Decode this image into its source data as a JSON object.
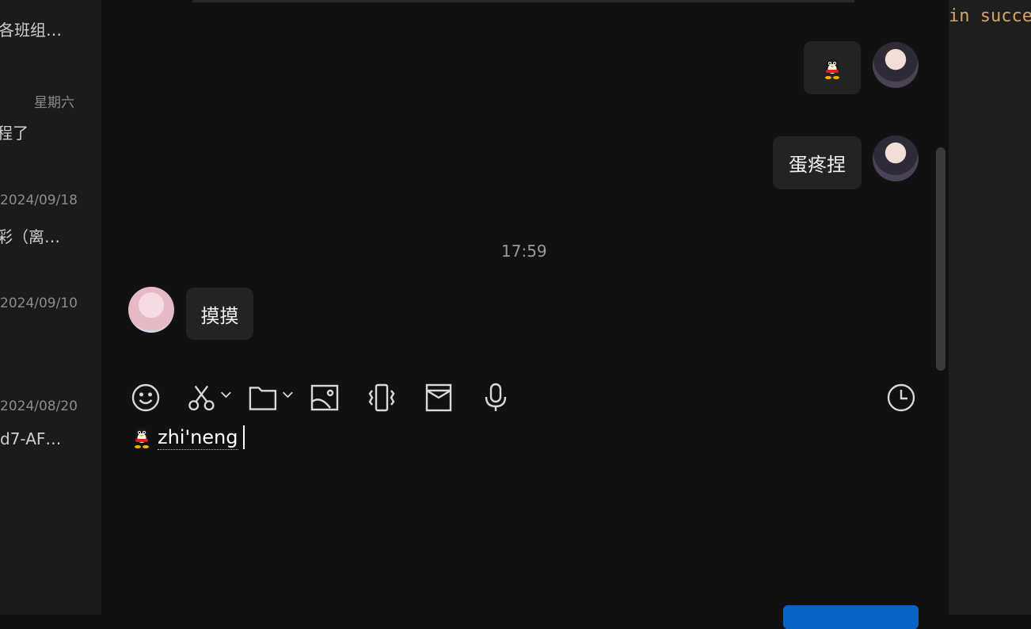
{
  "conversation_list": {
    "items": [
      {
        "preview": "各班组…",
        "date": "星期六"
      },
      {
        "preview": "程了",
        "date": "2024/09/18"
      },
      {
        "preview": "彩（离…",
        "date": "2024/09/10"
      },
      {
        "preview": "",
        "date": "2024/08/20"
      },
      {
        "preview": "d7-AF…",
        "date": ""
      }
    ]
  },
  "messages": [
    {
      "from": "self",
      "type": "sticker",
      "text": ""
    },
    {
      "from": "self",
      "type": "text",
      "text": "蛋疼捏"
    },
    {
      "type": "time",
      "text": "17:59"
    },
    {
      "from": "peer",
      "type": "text",
      "text": "摸摸"
    }
  ],
  "toolbar": {
    "icons": [
      "emoji-icon",
      "screenshot-scissors-icon",
      "folder-icon",
      "image-icon",
      "shake-icon",
      "red-packet-icon",
      "microphone-icon",
      "history-clock-icon"
    ]
  },
  "composer": {
    "text": "zhi'neng"
  },
  "code": {
    "line": "in succe"
  },
  "colors": {
    "background": "#111111",
    "bubble": "#232323",
    "accent": "#0a64c8",
    "code": "#d7a266"
  }
}
